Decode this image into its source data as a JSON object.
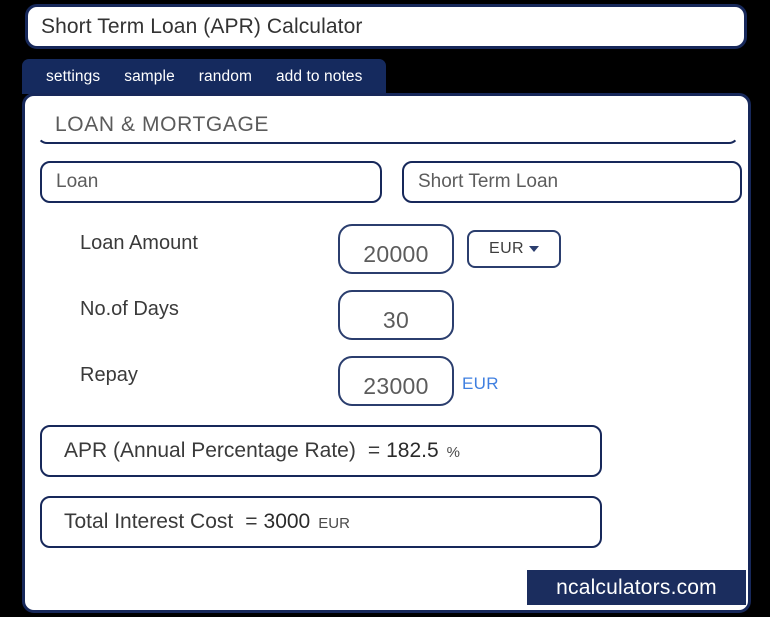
{
  "window": {
    "title": "Short Term Loan (APR) Calculator"
  },
  "tabs": [
    {
      "label": "settings"
    },
    {
      "label": "sample"
    },
    {
      "label": "random"
    },
    {
      "label": "add to notes"
    }
  ],
  "section": {
    "header": "LOAN & MORTGAGE"
  },
  "selects": {
    "category": {
      "value": "Loan",
      "caret_icon": "chevron-down-icon"
    },
    "calculator_type": {
      "value": "Short Term Loan",
      "caret_icon": "chevron-down-icon"
    }
  },
  "fields": [
    {
      "label": "Loan Amount",
      "value": "20000",
      "currency": "EUR",
      "currency_caret_icon": "caret-down-icon"
    },
    {
      "label": "No.of Days",
      "value": "30"
    },
    {
      "label": "Repay",
      "value": "23000",
      "unit": "EUR"
    }
  ],
  "results": [
    {
      "label": "APR (Annual Percentage Rate)",
      "equals": "=",
      "value": "182.5",
      "unit": "%"
    },
    {
      "label": "Total Interest Cost",
      "equals": "=",
      "value": "3000",
      "unit": "EUR"
    }
  ],
  "watermark": {
    "text": "ncalculators.com"
  },
  "colors": {
    "navy": "#17285a",
    "tab_bar": "#152a5e",
    "link_blue": "#3f7fe0",
    "label_gray": "#3a3a3a",
    "value_gray": "#5c5c5c",
    "page_background": "#000000"
  }
}
